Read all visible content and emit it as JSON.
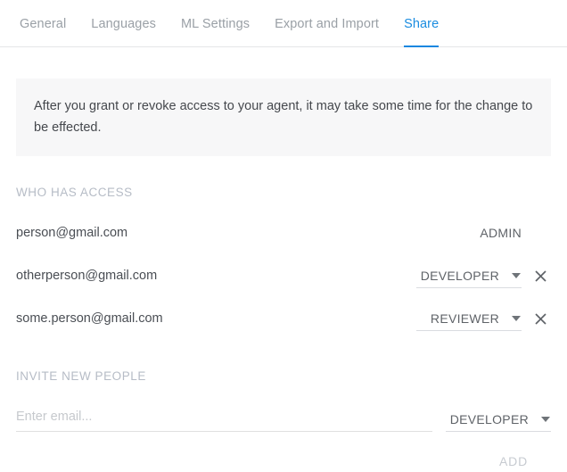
{
  "tabs": [
    {
      "label": "General",
      "active": false
    },
    {
      "label": "Languages",
      "active": false
    },
    {
      "label": "ML Settings",
      "active": false
    },
    {
      "label": "Export and Import",
      "active": false
    },
    {
      "label": "Share",
      "active": true
    }
  ],
  "notice": {
    "text": "After you grant or revoke access to your agent, it may take some time for the change to be effected."
  },
  "sections": {
    "who_has_access": "WHO HAS ACCESS",
    "invite_new_people": "INVITE NEW PEOPLE"
  },
  "access": [
    {
      "email": "person@gmail.com",
      "role": "ADMIN",
      "editable": false,
      "removable": false
    },
    {
      "email": "otherperson@gmail.com",
      "role": "DEVELOPER",
      "editable": true,
      "removable": true
    },
    {
      "email": "some.person@gmail.com",
      "role": "REVIEWER",
      "editable": true,
      "removable": true
    }
  ],
  "invite": {
    "email_value": "",
    "email_placeholder": "Enter email...",
    "role": "DEVELOPER",
    "add_label": "ADD"
  },
  "icons": {
    "chevron_down": "chevron-down-icon",
    "close": "close-icon"
  },
  "colors": {
    "accent": "#1787e0",
    "tab_inactive": "#9aa0a6",
    "section_label": "#b6bcc6",
    "notice_bg": "#f7f7f8",
    "text": "#45484d",
    "disabled": "#c7cbd1"
  }
}
